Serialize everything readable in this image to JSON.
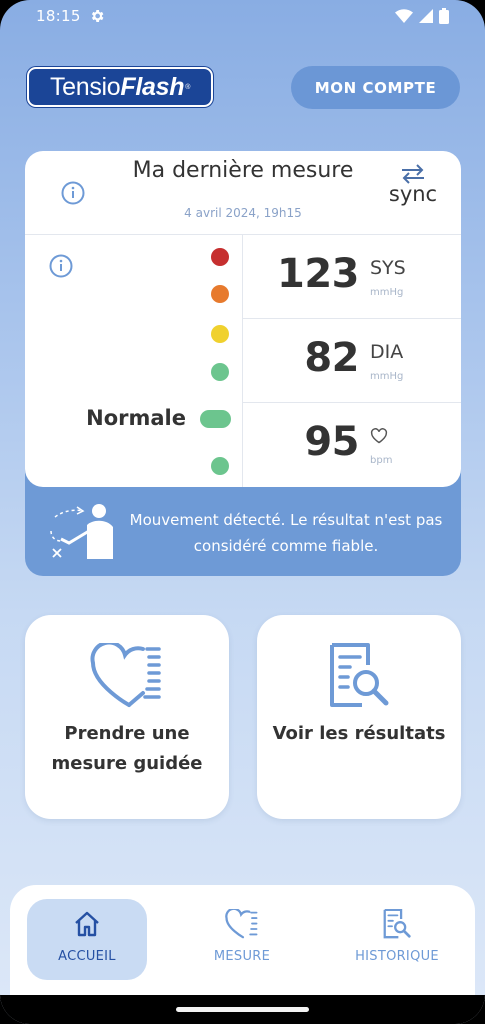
{
  "status_bar": {
    "time": "18:15"
  },
  "header": {
    "logo_part1": "Tensio",
    "logo_part2": "Flash",
    "logo_reg": "®",
    "account_button": "MON COMPTE"
  },
  "measure_card": {
    "title": "Ma dernière mesure",
    "date": "4 avril 2024, 19h15",
    "sync_label": "sync",
    "category_label": "Normale",
    "scale_colors": [
      "#c62f2f",
      "#e77a2d",
      "#f0d12e",
      "#6cc58e",
      "#6cc58e",
      "#6cc58e"
    ],
    "readings": [
      {
        "value": "123",
        "unit": "SYS",
        "sub": "mmHg"
      },
      {
        "value": "82",
        "unit": "DIA",
        "sub": "mmHg"
      },
      {
        "value": "95",
        "unit": "",
        "sub": "bpm"
      }
    ],
    "warning": "Mouvement détecté. Le résultat n'est pas considéré comme fiable."
  },
  "actions": {
    "guided": "Prendre une mesure guidée",
    "results": "Voir les résultats"
  },
  "nav": {
    "home": "ACCUEIL",
    "measure": "MESURE",
    "history": "HISTORIQUE"
  },
  "colors": {
    "brand": "#1b4597",
    "accent": "#6e9ad6",
    "active_nav_bg": "#c9dbf3"
  }
}
